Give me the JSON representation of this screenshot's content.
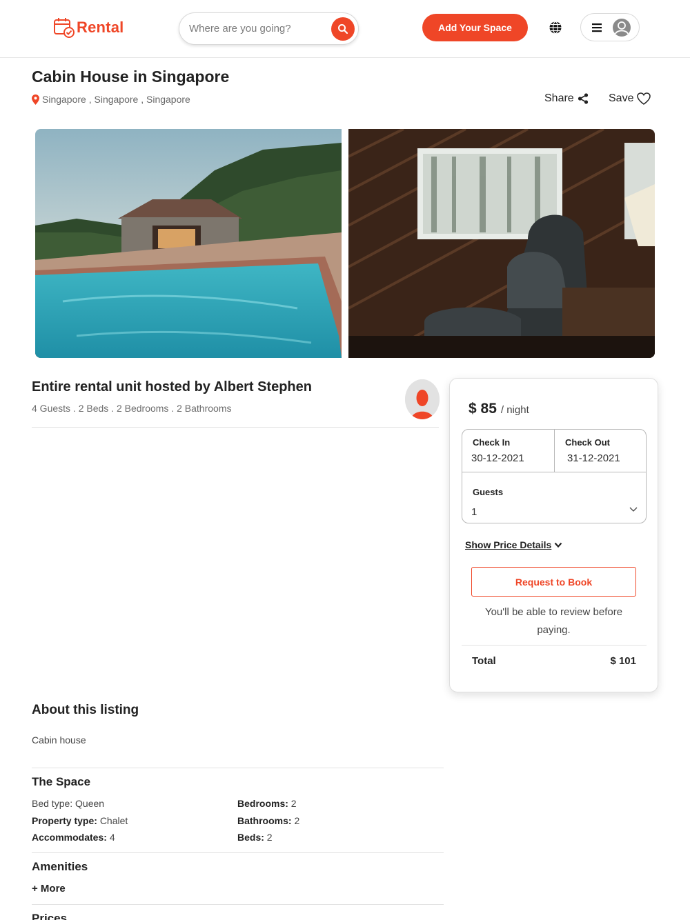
{
  "header": {
    "logo_text": "Rental",
    "search_placeholder": "Where are you going?",
    "add_space_label": "Add Your Space",
    "brand_color": "#ef4627"
  },
  "listing": {
    "title": "Cabin House in Singapore",
    "location": "Singapore , Singapore , Singapore",
    "share_label": "Share",
    "save_label": "Save",
    "photos": [
      "pool-cabin-exterior",
      "cabin-interior-armchair"
    ]
  },
  "host": {
    "title": "Entire rental unit hosted by Albert Stephen",
    "stats": "4 Guests . 2 Beds . 2 Bedrooms . 2 Bathrooms"
  },
  "booking": {
    "price": "$ 85",
    "price_unit": "/ night",
    "check_in_label": "Check In",
    "check_in_value": "30-12-2021",
    "check_out_label": "Check Out",
    "check_out_value": "31-12-2021",
    "guests_label": "Guests",
    "guests_value": "1",
    "price_details_label": "Show Price Details",
    "request_label": "Request to Book",
    "review_note": "You'll be able to review before paying.",
    "total_label": "Total",
    "total_value": "$ 101"
  },
  "about": {
    "heading": "About this listing",
    "text": "Cabin house",
    "space_heading": "The Space",
    "bed_type": "Bed type: Queen",
    "property_type_label": "Property type:",
    "property_type_value": "Chalet",
    "accommodates_label": "Accommodates:",
    "accommodates_value": "4",
    "bedrooms_label": "Bedrooms:",
    "bedrooms_value": "2",
    "bathrooms_label": "Bathrooms:",
    "bathrooms_value": "2",
    "beds_label": "Beds:",
    "beds_value": "2",
    "amenities_heading": "Amenities",
    "more_label": "+ More",
    "prices_heading": "Prices"
  }
}
